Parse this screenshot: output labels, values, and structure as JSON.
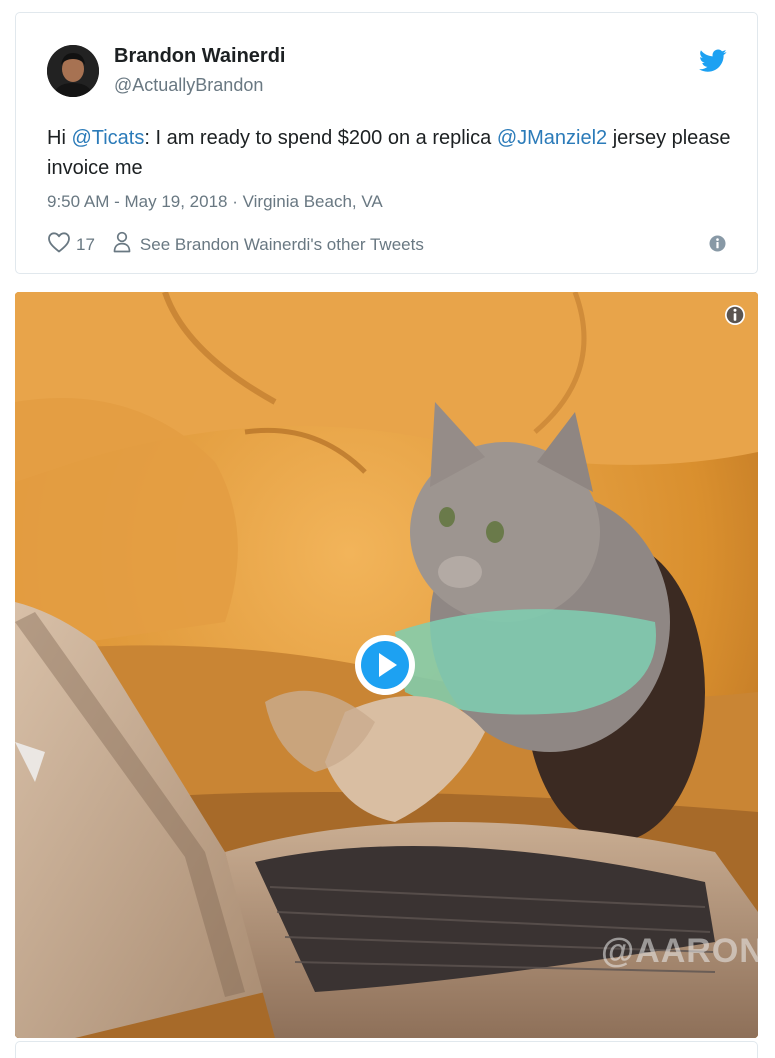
{
  "tweet": {
    "author_name": "Brandon Wainerdi",
    "author_handle": "@ActuallyBrandon",
    "text_parts": {
      "t1": "Hi ",
      "m1": "@Ticats",
      "t2": ": I am ready to spend $200 on a replica ",
      "m2": "@JManziel2",
      "t3": " jersey please invoice me"
    },
    "meta": "9:50 AM - May 19, 2018 · Virginia Beach, VA",
    "like_count": "17",
    "other_tweets_label": "See Brandon Wainerdi's other Tweets"
  },
  "media": {
    "watermark": "@AARON"
  },
  "icons": {
    "logo": "twitter-bird-icon",
    "like": "heart-icon",
    "profile": "person-icon",
    "info": "info-icon",
    "play": "play-icon"
  },
  "colors": {
    "accent": "#1da1f2",
    "link": "#2b7bb9",
    "text": "#1c2022",
    "muted": "#697882"
  }
}
